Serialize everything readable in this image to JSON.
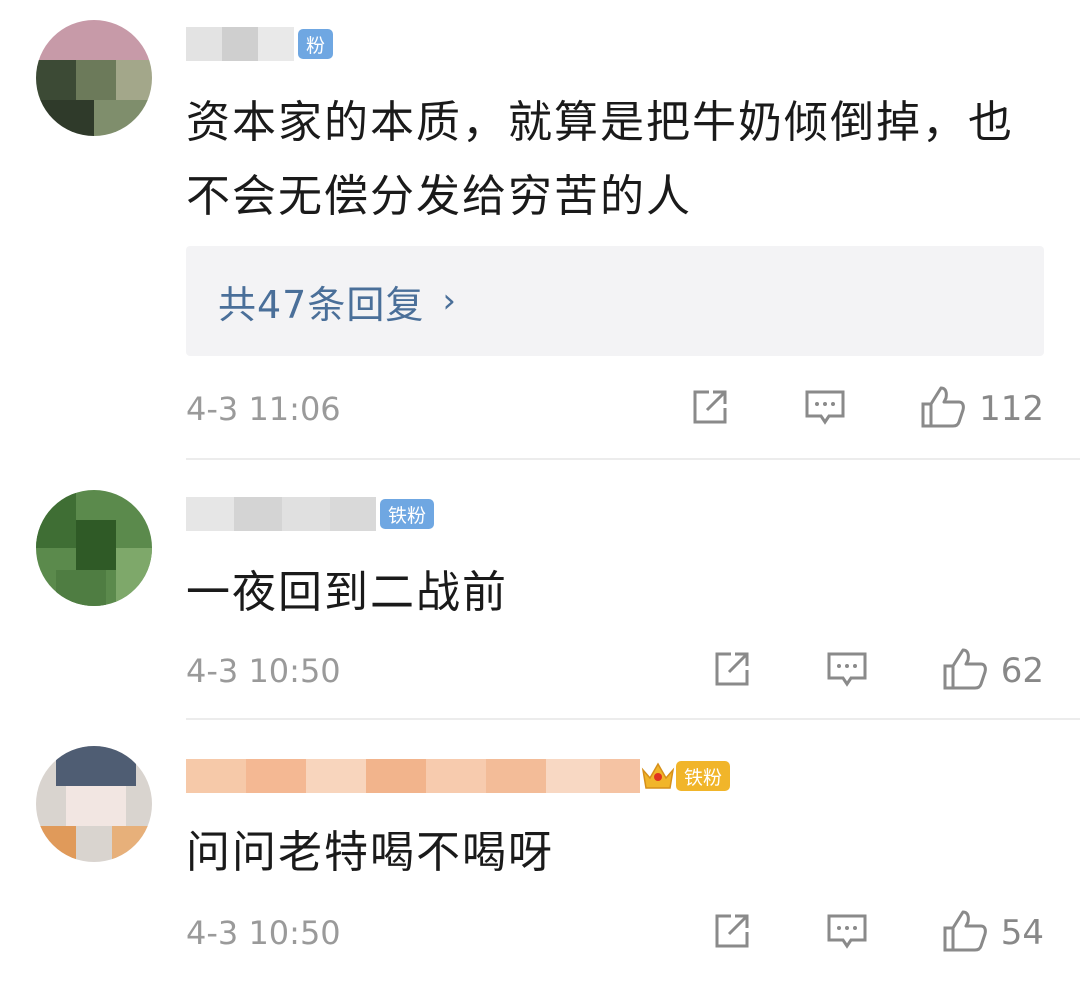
{
  "comments": [
    {
      "badge": "粉",
      "text": "资本家的本质，就算是把牛奶倾倒掉，也不会无偿分发给穷苦的人",
      "replies_label": "共47条回复",
      "time": "4-3 11:06",
      "likes": "112"
    },
    {
      "badge": "铁粉",
      "text": "一夜回到二战前",
      "time": "4-3 10:50",
      "likes": "62"
    },
    {
      "badge": "铁粉",
      "text": "问问老特喝不喝呀",
      "time": "4-3 10:50",
      "likes": "54"
    }
  ],
  "icons": {
    "share": "share-icon",
    "comment": "comment-icon",
    "like": "thumbs-up-icon",
    "chevron": "chevron-right-icon"
  },
  "colors": {
    "link": "#4a6f99",
    "meta": "#9a9a9a",
    "badge_blue": "#6fa7e2",
    "badge_gold": "#f1b52a"
  }
}
